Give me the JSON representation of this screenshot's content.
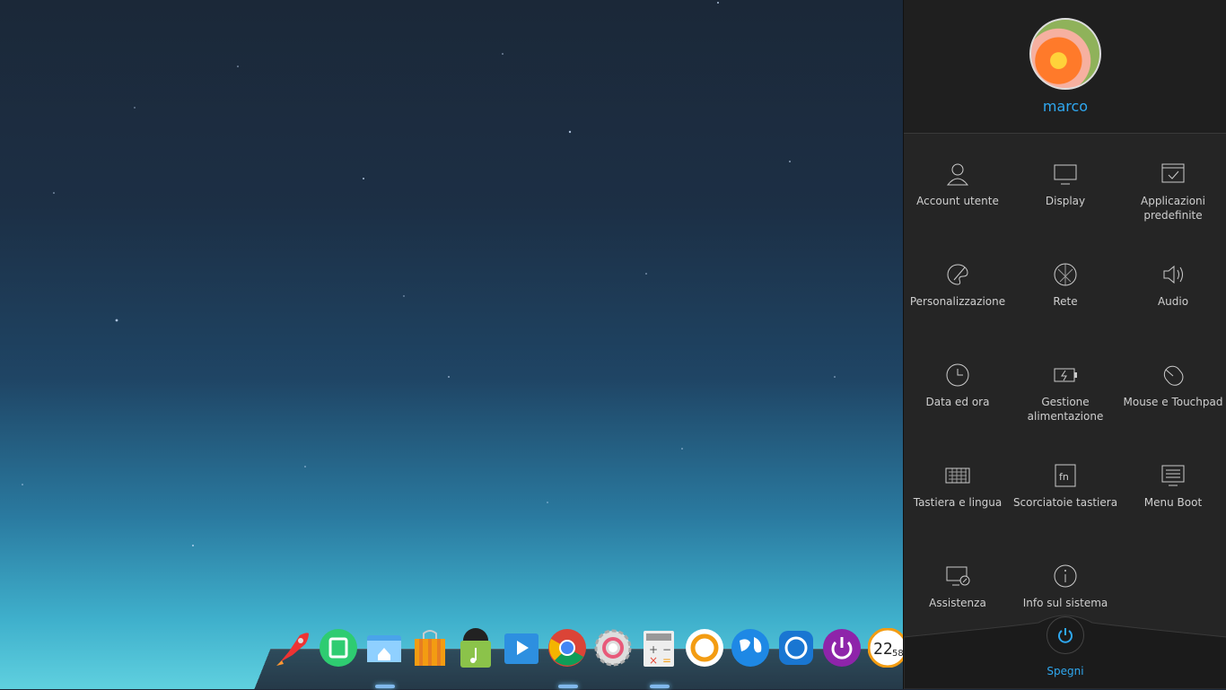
{
  "user": {
    "name": "marco"
  },
  "settings": [
    {
      "label": "Account utente",
      "icon": "user-icon"
    },
    {
      "label": "Display",
      "icon": "monitor-icon"
    },
    {
      "label": "Applicazioni predefinite",
      "icon": "default-apps-icon"
    },
    {
      "label": "Personalizzazione",
      "icon": "palette-icon"
    },
    {
      "label": "Rete",
      "icon": "network-icon"
    },
    {
      "label": "Audio",
      "icon": "speaker-icon"
    },
    {
      "label": "Data ed ora",
      "icon": "clock-icon"
    },
    {
      "label": "Gestione alimentazione",
      "icon": "battery-icon"
    },
    {
      "label": "Mouse e Touchpad",
      "icon": "mouse-icon"
    },
    {
      "label": "Tastiera e lingua",
      "icon": "keyboard-icon"
    },
    {
      "label": "Scorciatoie tastiera",
      "icon": "fn-key-icon"
    },
    {
      "label": "Menu Boot",
      "icon": "boot-menu-icon"
    },
    {
      "label": "Assistenza",
      "icon": "remote-assistance-icon"
    },
    {
      "label": "Info sul sistema",
      "icon": "info-icon"
    }
  ],
  "power": {
    "label": "Spegni"
  },
  "dock": {
    "apps": [
      "launcher-icon",
      "app-store-icon",
      "file-manager-icon",
      "shop-icon",
      "music-icon",
      "video-icon",
      "chrome-icon",
      "settings-icon",
      "calculator-icon",
      "deepin-icon",
      "browser-globe-icon",
      "network-tool-icon",
      "shutdown-icon",
      "clock-icon"
    ],
    "clock_text": "22",
    "clock_sub": "58"
  },
  "colors": {
    "accent": "#2fa8f0",
    "panel_bg": "#252525"
  }
}
